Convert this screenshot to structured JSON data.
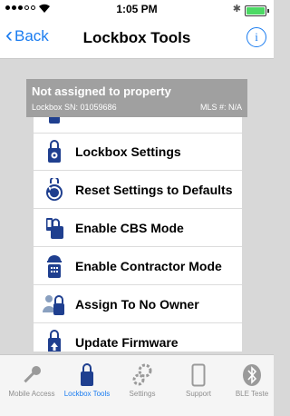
{
  "status_bar": {
    "time": "1:05 PM",
    "bluetooth_glyph": "✱"
  },
  "nav": {
    "back_label": "Back",
    "title": "Lockbox Tools",
    "info_glyph": "i"
  },
  "header": {
    "title": "Not assigned to property",
    "serial": "Lockbox SN: 01059686",
    "mls": "MLS #: N/A"
  },
  "menu": {
    "items": [
      {
        "label": "Lockbox Settings",
        "icon": "lockbox-gear-icon"
      },
      {
        "label": "Reset Settings to Defaults",
        "icon": "reset-icon"
      },
      {
        "label": "Enable CBS Mode",
        "icon": "cbs-mode-icon"
      },
      {
        "label": "Enable Contractor Mode",
        "icon": "contractor-mode-icon"
      },
      {
        "label": "Assign To No Owner",
        "icon": "assign-owner-icon"
      },
      {
        "label": "Update Firmware",
        "icon": "firmware-update-icon"
      }
    ]
  },
  "tabs": [
    {
      "label": "Mobile Access",
      "icon": "key-icon",
      "active": false
    },
    {
      "label": "Lockbox Tools",
      "icon": "lockbox-icon",
      "active": true
    },
    {
      "label": "Settings",
      "icon": "gears-icon",
      "active": false
    },
    {
      "label": "Support",
      "icon": "phone-icon",
      "active": false
    },
    {
      "label": "BLE Teste",
      "icon": "bluetooth-icon",
      "active": false
    }
  ],
  "colors": {
    "accent": "#1a7cf0",
    "brand_navy": "#1f3f8f",
    "header_gray": "#a0a0a0"
  }
}
